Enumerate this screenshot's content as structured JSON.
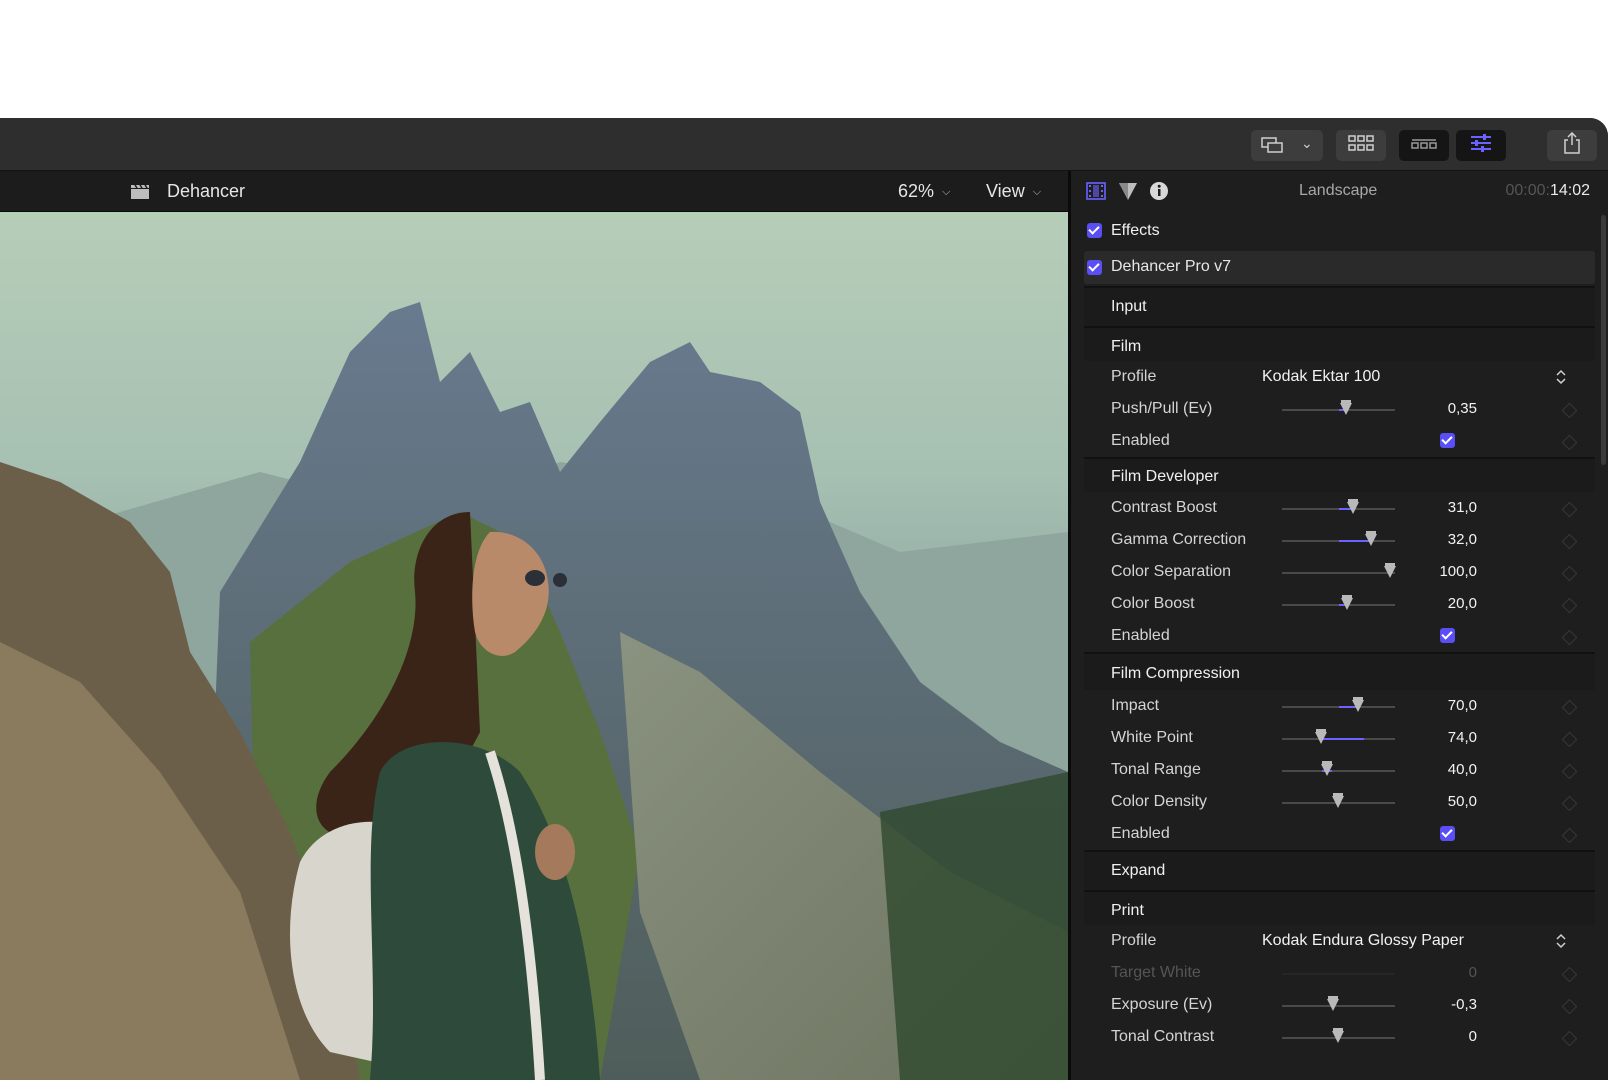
{
  "viewer": {
    "title": "Dehancer",
    "zoom": "62%",
    "view_label": "View"
  },
  "inspector": {
    "title": "Landscape",
    "time_dim": "00:00:",
    "time": "14:02",
    "effects_label": "Effects",
    "plugin_label": "Dehancer Pro v7",
    "sections": {
      "input": "Input",
      "film": "Film",
      "film_developer": "Film Developer",
      "film_compression": "Film Compression",
      "expand": "Expand",
      "print": "Print"
    },
    "film": {
      "profile_label": "Profile",
      "profile_value": "Kodak Ektar 100",
      "push_pull_label": "Push/Pull (Ev)",
      "push_pull_value": "0,35",
      "enabled_label": "Enabled"
    },
    "film_developer": {
      "contrast_boost_label": "Contrast Boost",
      "contrast_boost_value": "31,0",
      "gamma_label": "Gamma Correction",
      "gamma_value": "32,0",
      "color_sep_label": "Color Separation",
      "color_sep_value": "100,0",
      "color_boost_label": "Color Boost",
      "color_boost_value": "20,0",
      "enabled_label": "Enabled"
    },
    "film_compression": {
      "impact_label": "Impact",
      "impact_value": "70,0",
      "white_point_label": "White Point",
      "white_point_value": "74,0",
      "tonal_range_label": "Tonal Range",
      "tonal_range_value": "40,0",
      "color_density_label": "Color Density",
      "color_density_value": "50,0",
      "enabled_label": "Enabled"
    },
    "print": {
      "profile_label": "Profile",
      "profile_value": "Kodak Endura Glossy Paper",
      "target_white_label": "Target White",
      "target_white_value": "0",
      "exposure_label": "Exposure (Ev)",
      "exposure_value": "-0,3",
      "tonal_contrast_label": "Tonal Contrast",
      "tonal_contrast_value": "0"
    }
  },
  "colors": {
    "accent": "#5a4ff5",
    "slider_fill": "#6b63ff",
    "panel_bg": "#1e1e1e"
  }
}
